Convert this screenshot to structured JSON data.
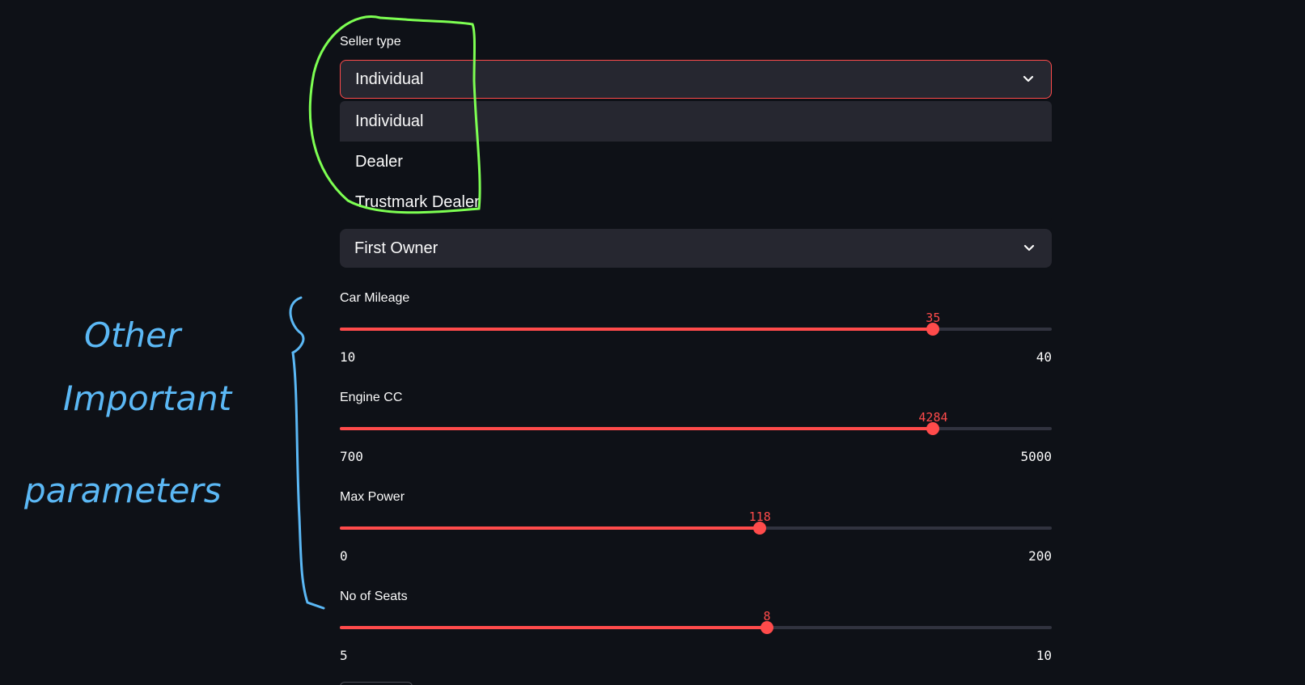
{
  "seller": {
    "label": "Seller type",
    "value": "Individual",
    "options": [
      "Individual",
      "Dealer",
      "Trustmark Dealer"
    ]
  },
  "owner": {
    "value": "First Owner"
  },
  "sliders": [
    {
      "label": "Car Mileage",
      "min": "10",
      "max": "40",
      "value": "35"
    },
    {
      "label": "Engine CC",
      "min": "700",
      "max": "5000",
      "value": "4284"
    },
    {
      "label": "Max Power",
      "min": "0",
      "max": "200",
      "value": "118"
    },
    {
      "label": "No of Seats",
      "min": "5",
      "max": "10",
      "value": "8"
    }
  ],
  "annotation": {
    "lines": [
      "Other",
      "Important",
      "parameters"
    ],
    "color": "#5bb8f5",
    "highlight_color": "#7dff52"
  },
  "colors": {
    "accent": "#ff4b4b",
    "background": "#0e1117",
    "widget": "#262730"
  }
}
